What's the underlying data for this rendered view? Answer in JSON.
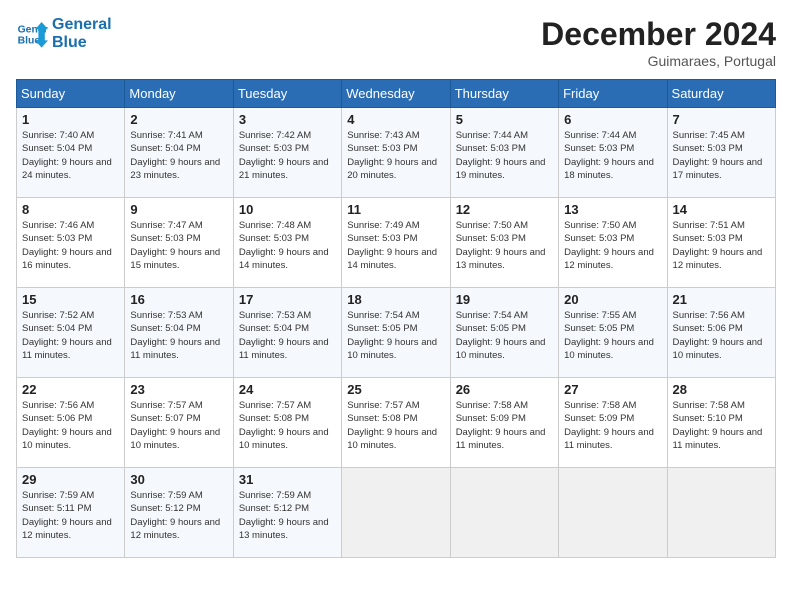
{
  "header": {
    "logo_line1": "General",
    "logo_line2": "Blue",
    "month": "December 2024",
    "location": "Guimaraes, Portugal"
  },
  "weekdays": [
    "Sunday",
    "Monday",
    "Tuesday",
    "Wednesday",
    "Thursday",
    "Friday",
    "Saturday"
  ],
  "weeks": [
    [
      {
        "day": "1",
        "sunrise": "Sunrise: 7:40 AM",
        "sunset": "Sunset: 5:04 PM",
        "daylight": "Daylight: 9 hours and 24 minutes."
      },
      {
        "day": "2",
        "sunrise": "Sunrise: 7:41 AM",
        "sunset": "Sunset: 5:04 PM",
        "daylight": "Daylight: 9 hours and 23 minutes."
      },
      {
        "day": "3",
        "sunrise": "Sunrise: 7:42 AM",
        "sunset": "Sunset: 5:03 PM",
        "daylight": "Daylight: 9 hours and 21 minutes."
      },
      {
        "day": "4",
        "sunrise": "Sunrise: 7:43 AM",
        "sunset": "Sunset: 5:03 PM",
        "daylight": "Daylight: 9 hours and 20 minutes."
      },
      {
        "day": "5",
        "sunrise": "Sunrise: 7:44 AM",
        "sunset": "Sunset: 5:03 PM",
        "daylight": "Daylight: 9 hours and 19 minutes."
      },
      {
        "day": "6",
        "sunrise": "Sunrise: 7:44 AM",
        "sunset": "Sunset: 5:03 PM",
        "daylight": "Daylight: 9 hours and 18 minutes."
      },
      {
        "day": "7",
        "sunrise": "Sunrise: 7:45 AM",
        "sunset": "Sunset: 5:03 PM",
        "daylight": "Daylight: 9 hours and 17 minutes."
      }
    ],
    [
      {
        "day": "8",
        "sunrise": "Sunrise: 7:46 AM",
        "sunset": "Sunset: 5:03 PM",
        "daylight": "Daylight: 9 hours and 16 minutes."
      },
      {
        "day": "9",
        "sunrise": "Sunrise: 7:47 AM",
        "sunset": "Sunset: 5:03 PM",
        "daylight": "Daylight: 9 hours and 15 minutes."
      },
      {
        "day": "10",
        "sunrise": "Sunrise: 7:48 AM",
        "sunset": "Sunset: 5:03 PM",
        "daylight": "Daylight: 9 hours and 14 minutes."
      },
      {
        "day": "11",
        "sunrise": "Sunrise: 7:49 AM",
        "sunset": "Sunset: 5:03 PM",
        "daylight": "Daylight: 9 hours and 14 minutes."
      },
      {
        "day": "12",
        "sunrise": "Sunrise: 7:50 AM",
        "sunset": "Sunset: 5:03 PM",
        "daylight": "Daylight: 9 hours and 13 minutes."
      },
      {
        "day": "13",
        "sunrise": "Sunrise: 7:50 AM",
        "sunset": "Sunset: 5:03 PM",
        "daylight": "Daylight: 9 hours and 12 minutes."
      },
      {
        "day": "14",
        "sunrise": "Sunrise: 7:51 AM",
        "sunset": "Sunset: 5:03 PM",
        "daylight": "Daylight: 9 hours and 12 minutes."
      }
    ],
    [
      {
        "day": "15",
        "sunrise": "Sunrise: 7:52 AM",
        "sunset": "Sunset: 5:04 PM",
        "daylight": "Daylight: 9 hours and 11 minutes."
      },
      {
        "day": "16",
        "sunrise": "Sunrise: 7:53 AM",
        "sunset": "Sunset: 5:04 PM",
        "daylight": "Daylight: 9 hours and 11 minutes."
      },
      {
        "day": "17",
        "sunrise": "Sunrise: 7:53 AM",
        "sunset": "Sunset: 5:04 PM",
        "daylight": "Daylight: 9 hours and 11 minutes."
      },
      {
        "day": "18",
        "sunrise": "Sunrise: 7:54 AM",
        "sunset": "Sunset: 5:05 PM",
        "daylight": "Daylight: 9 hours and 10 minutes."
      },
      {
        "day": "19",
        "sunrise": "Sunrise: 7:54 AM",
        "sunset": "Sunset: 5:05 PM",
        "daylight": "Daylight: 9 hours and 10 minutes."
      },
      {
        "day": "20",
        "sunrise": "Sunrise: 7:55 AM",
        "sunset": "Sunset: 5:05 PM",
        "daylight": "Daylight: 9 hours and 10 minutes."
      },
      {
        "day": "21",
        "sunrise": "Sunrise: 7:56 AM",
        "sunset": "Sunset: 5:06 PM",
        "daylight": "Daylight: 9 hours and 10 minutes."
      }
    ],
    [
      {
        "day": "22",
        "sunrise": "Sunrise: 7:56 AM",
        "sunset": "Sunset: 5:06 PM",
        "daylight": "Daylight: 9 hours and 10 minutes."
      },
      {
        "day": "23",
        "sunrise": "Sunrise: 7:57 AM",
        "sunset": "Sunset: 5:07 PM",
        "daylight": "Daylight: 9 hours and 10 minutes."
      },
      {
        "day": "24",
        "sunrise": "Sunrise: 7:57 AM",
        "sunset": "Sunset: 5:08 PM",
        "daylight": "Daylight: 9 hours and 10 minutes."
      },
      {
        "day": "25",
        "sunrise": "Sunrise: 7:57 AM",
        "sunset": "Sunset: 5:08 PM",
        "daylight": "Daylight: 9 hours and 10 minutes."
      },
      {
        "day": "26",
        "sunrise": "Sunrise: 7:58 AM",
        "sunset": "Sunset: 5:09 PM",
        "daylight": "Daylight: 9 hours and 11 minutes."
      },
      {
        "day": "27",
        "sunrise": "Sunrise: 7:58 AM",
        "sunset": "Sunset: 5:09 PM",
        "daylight": "Daylight: 9 hours and 11 minutes."
      },
      {
        "day": "28",
        "sunrise": "Sunrise: 7:58 AM",
        "sunset": "Sunset: 5:10 PM",
        "daylight": "Daylight: 9 hours and 11 minutes."
      }
    ],
    [
      {
        "day": "29",
        "sunrise": "Sunrise: 7:59 AM",
        "sunset": "Sunset: 5:11 PM",
        "daylight": "Daylight: 9 hours and 12 minutes."
      },
      {
        "day": "30",
        "sunrise": "Sunrise: 7:59 AM",
        "sunset": "Sunset: 5:12 PM",
        "daylight": "Daylight: 9 hours and 12 minutes."
      },
      {
        "day": "31",
        "sunrise": "Sunrise: 7:59 AM",
        "sunset": "Sunset: 5:12 PM",
        "daylight": "Daylight: 9 hours and 13 minutes."
      },
      null,
      null,
      null,
      null
    ]
  ]
}
